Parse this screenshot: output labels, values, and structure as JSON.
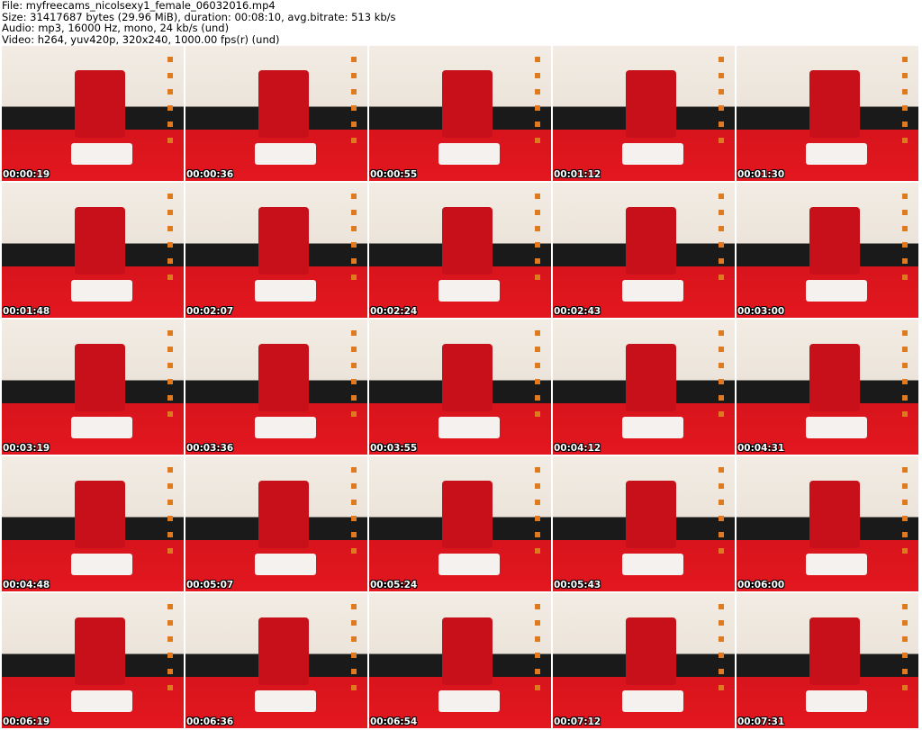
{
  "header": {
    "file": "File: myfreecams_nicolsexy1_female_06032016.mp4",
    "size": "Size: 31417687 bytes (29.96 MiB), duration: 00:08:10, avg.bitrate: 513 kb/s",
    "audio": "Audio: mp3, 16000 Hz, mono, 24 kb/s (und)",
    "video": "Video: h264, yuv420p, 320x240, 1000.00 fps(r) (und)"
  },
  "thumbnails": [
    "00:00:19",
    "00:00:36",
    "00:00:55",
    "00:01:12",
    "00:01:30",
    "00:01:48",
    "00:02:07",
    "00:02:24",
    "00:02:43",
    "00:03:00",
    "00:03:19",
    "00:03:36",
    "00:03:55",
    "00:04:12",
    "00:04:31",
    "00:04:48",
    "00:05:07",
    "00:05:24",
    "00:05:43",
    "00:06:00",
    "00:06:19",
    "00:06:36",
    "00:06:54",
    "00:07:12",
    "00:07:31"
  ]
}
